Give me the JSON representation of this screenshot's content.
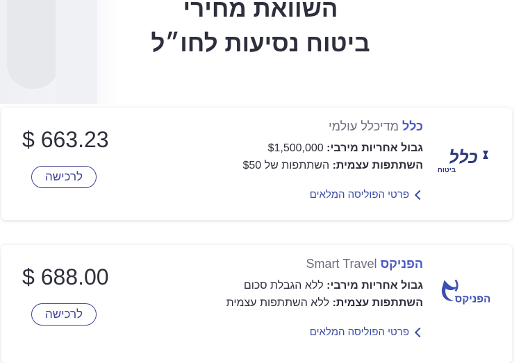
{
  "hero": {
    "title_line1": "השוואת מחירי",
    "title_line2": "ביטוח נסיעות לחו״ל"
  },
  "offers": [
    {
      "company": "כלל",
      "plan": "מדיכלל עולמי",
      "liability_label": "גבול אחריות מירבי:",
      "liability_value": "$1,500,000",
      "deductible_label": "השתתפות עצמית:",
      "deductible_value": "השתתפות של $50",
      "policy_link": "פרטי הפוליסה המלאים",
      "price": "$ 663.23",
      "buy_label": "לרכישה",
      "logo_text_main": "כלל",
      "logo_text_sub": "ביטוח",
      "logo_icon": "clal-logo"
    },
    {
      "company": "הפניקס",
      "plan": "Smart Travel",
      "liability_label": "גבול אחריות מירבי:",
      "liability_value": "ללא הגבלת סכום",
      "deductible_label": "השתתפות עצמית:",
      "deductible_value": "ללא השתתפות עצמית",
      "policy_link": "פרטי הפוליסה המלאים",
      "price": "$ 688.00",
      "buy_label": "לרכישה",
      "logo_text_main": "הפניקס",
      "logo_icon": "phoenix-logo"
    }
  ],
  "colors": {
    "brand_blue": "#4a59c7",
    "link_blue": "#3b4aa6",
    "button_border": "#3d4396",
    "text_dark": "#2d2f3c",
    "text_muted": "#6b6e7c",
    "clal_logo": "#2f3a7c"
  }
}
